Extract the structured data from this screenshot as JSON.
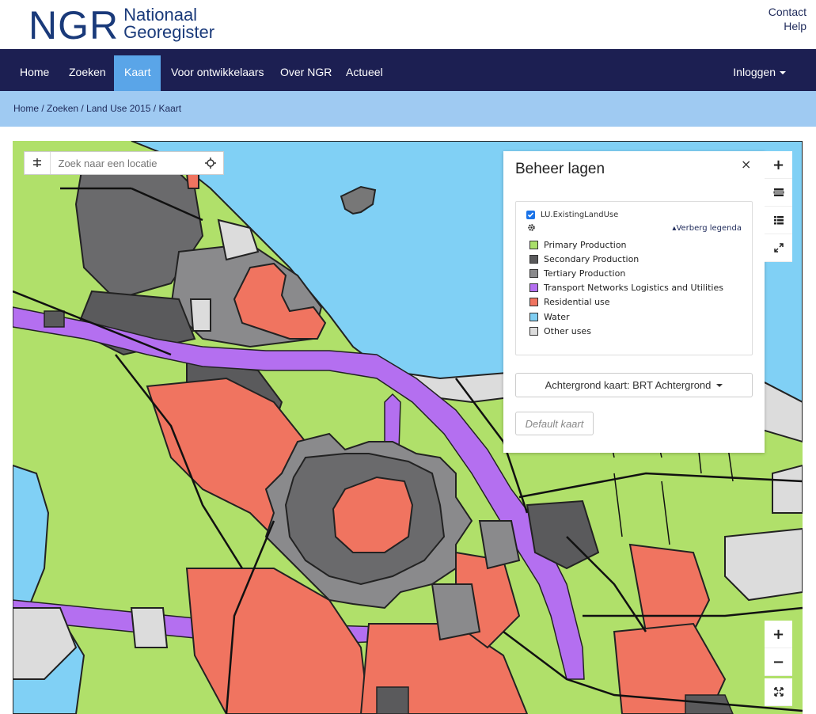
{
  "header": {
    "logo_main": "NGR",
    "logo_line1": "Nationaal",
    "logo_line2": "Georegister",
    "links": [
      "Contact",
      "Help"
    ]
  },
  "nav": {
    "items": [
      "Home",
      "Zoeken",
      "Kaart",
      "Voor ontwikkelaars",
      "Over NGR",
      "Actueel"
    ],
    "active": "Kaart",
    "login": "Inloggen"
  },
  "breadcrumb": "Home / Zoeken / Land Use 2015 / Kaart",
  "search": {
    "placeholder": "Zoek naar een locatie"
  },
  "panel": {
    "title": "Beheer lagen",
    "close": "×",
    "layer_name": "LU.ExistingLandUse",
    "layer_checked": true,
    "toggle_legend": "Verberg legenda",
    "legend": [
      {
        "label": "Primary Production",
        "color": "#a9df6a"
      },
      {
        "label": "Secondary Production",
        "color": "#5a5a5c"
      },
      {
        "label": "Tertiary Production",
        "color": "#8a8a8c"
      },
      {
        "label": "Transport Networks Logistics and Utilities",
        "color": "#b46ff0"
      },
      {
        "label": "Residential use",
        "color": "#f07460"
      },
      {
        "label": "Water",
        "color": "#80cef2"
      },
      {
        "label": "Other uses",
        "color": "#dcdcdc"
      }
    ],
    "background_button": "Achtergrond kaart: BRT Achtergrond",
    "default_button": "Default kaart"
  },
  "toolbar": {
    "zoom_in": "+",
    "zoom_out": "−"
  },
  "colors": {
    "navbar": "#1c1f52",
    "nav_active": "#5aa5e8",
    "breadcrumb_bg": "#9fcaf2",
    "water": "#80d0f5",
    "primary": "#b0e06a"
  }
}
